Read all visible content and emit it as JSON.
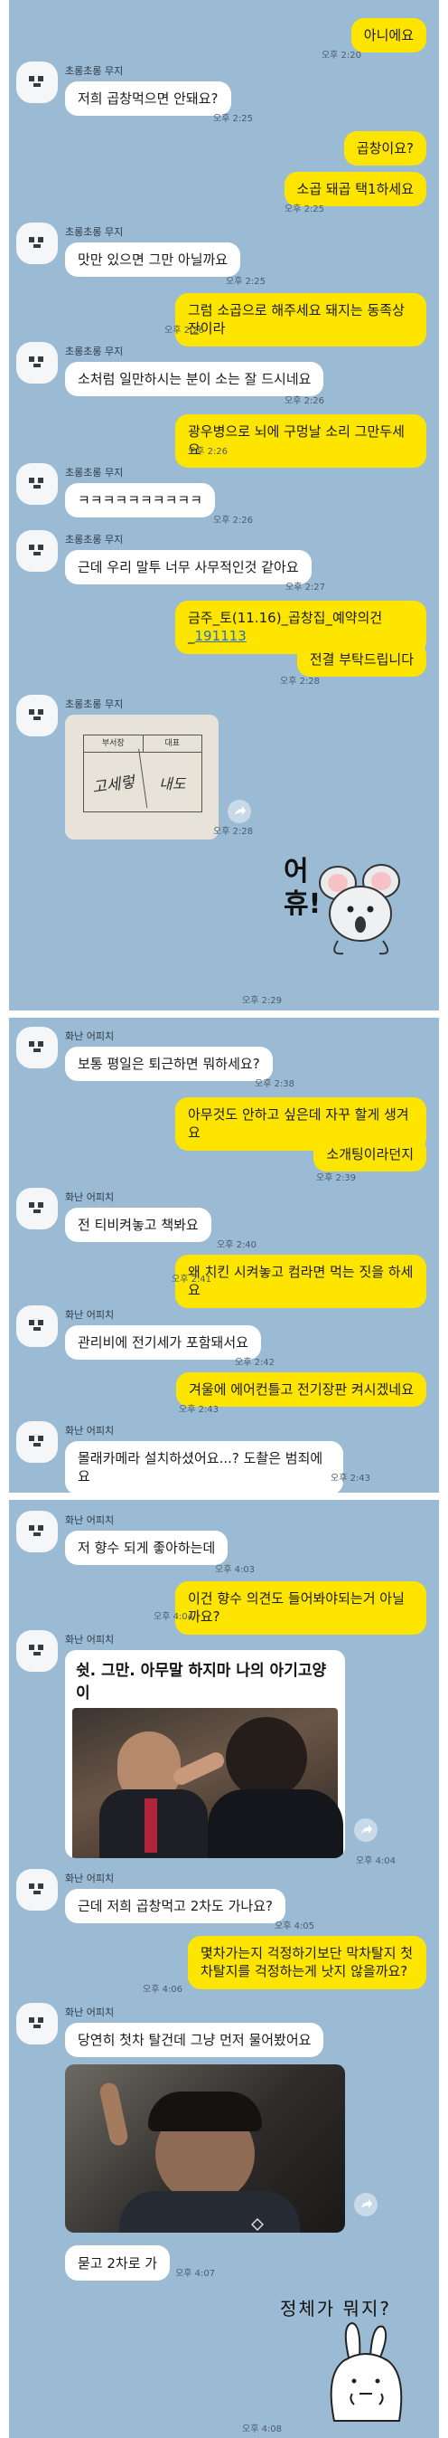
{
  "panel1": {
    "m1": {
      "text": "아니에요",
      "time": "오후 2:20"
    },
    "t1": {
      "name": "초롱초롱 무지",
      "text": "저희 곱창먹으면 안돼요?",
      "time": "오후 2:25"
    },
    "m2": {
      "text": "곱창이요?"
    },
    "m3": {
      "text": "소곱 돼곱 택1하세요",
      "time": "오후 2:25"
    },
    "t2": {
      "name": "초롱초롱 무지",
      "text": "맛만 있으면 그만 아닐까요",
      "time": "오후 2:25"
    },
    "m4": {
      "text": "그럼 소곱으로 해주세요 돼지는 동족상잔이라",
      "time": "오후 2:26"
    },
    "t3": {
      "name": "초롱초롱 무지",
      "text": "소처럼 일만하시는 분이 소는 잘 드시네요",
      "time": "오후 2:26"
    },
    "m5": {
      "text": "광우병으로 뇌에 구멍날 소리 그만두세요",
      "time": "오후 2:26"
    },
    "t4": {
      "name": "초롱초롱 무지",
      "text": "ㅋㅋㅋㅋㅋㅋㅋㅋㅋㅋ",
      "time": "오후 2:26"
    },
    "t5": {
      "name": "초롱초롱 무지",
      "text": "근데 우리 말투 너무 사무적인것 같아요",
      "time": "오후 2:27"
    },
    "m6": {
      "text_a": "금주_토(11.16)_곱창집_예약의건_",
      "text_b": "191113"
    },
    "m7": {
      "text": "전결 부탁드립니다",
      "time": "오후 2:28"
    },
    "t6": {
      "name": "초롱초롱 무지",
      "time": "오후 2:28",
      "stamp": {
        "col1": "부서장",
        "col2": "대표",
        "sign1": "고세렇",
        "sign2": "내도"
      }
    },
    "sticker1": {
      "text": "어휴!",
      "time": "오후 2:29"
    }
  },
  "panel2": {
    "t1": {
      "name": "화난 어피치",
      "text": "보통 평일은 퇴근하면 뭐하세요?",
      "time": "오후 2:38"
    },
    "m1": {
      "text": "아무것도 안하고 싶은데 자꾸 할게 생겨요"
    },
    "m2": {
      "text": "소개팅이라던지",
      "time": "오후 2:39"
    },
    "t2": {
      "name": "화난 어피치",
      "text": "전 티비켜놓고 책봐요",
      "time": "오후 2:40"
    },
    "m3": {
      "text": "왜 치킨 시켜놓고 컴라면 먹는 짓을 하세요",
      "time": "오후 2:41"
    },
    "t3": {
      "name": "화난 어피치",
      "text": "관리비에 전기세가 포함돼서요",
      "time": "오후 2:42"
    },
    "m4": {
      "text": "겨울에 에어컨틀고 전기장판 켜시겠네요",
      "time": "오후 2:43"
    },
    "t4": {
      "name": "화난 어피치",
      "text": "몰래카메라 설치하셨어요...? 도촬은 범죄에요",
      "time": "오후 2:43"
    }
  },
  "panel3": {
    "t1": {
      "name": "화난 어피치",
      "text": "저 향수 되게 좋아하는데",
      "time": "오후 4:03"
    },
    "m1": {
      "text": "이건 향수 의견도 들어봐야되는거 아닐까요?",
      "time": "오후 4:04"
    },
    "t2": {
      "name": "화난 어피치",
      "text": "쉿. 그만. 아무말 하지마 나의 아기고양이",
      "time": "오후 4:04"
    },
    "t3": {
      "name": "화난 어피치",
      "text": "근데 저희 곱창먹고 2차도 가나요?",
      "time": "오후 4:05"
    },
    "m2": {
      "text": "몇차가는지 걱정하기보단 막차탈지 첫차탈지를 걱정하는게 낫지 않을까요?",
      "time": "오후 4:06"
    },
    "t4": {
      "name": "화난 어피치",
      "text": "당연히 첫차 탈건데 그냥 먼저 물어봤어요"
    },
    "t5": {
      "text": "묻고 2차로 가",
      "time": "오후 4:07"
    },
    "sticker2": {
      "text": "정체가 뭐지?",
      "time": "오후 4:08"
    }
  },
  "colors": {
    "bg": "#9bbbd4",
    "mine": "#fee500",
    "theirs": "#ffffff"
  }
}
